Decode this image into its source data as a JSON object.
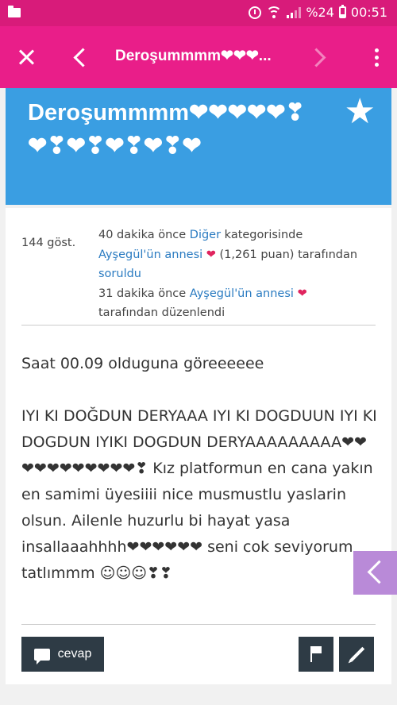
{
  "status_bar": {
    "battery_text": "%24",
    "time": "00:51"
  },
  "app_bar": {
    "title": "Deroşummmm❤❤❤..."
  },
  "question": {
    "title": "Deroşummmm❤❤❤❤❤❣❤❣❤❣❤❣❤❣❤"
  },
  "meta": {
    "views": "144 göst.",
    "asked_time": "40 dakika önce",
    "category": "Diğer",
    "category_suffix": "kategorisinde",
    "author": "Ayşegül'ün annesi",
    "heart": "❤",
    "points": "(1,261 puan)",
    "by": "tarafından",
    "asked_label": "soruldu",
    "edited_time": "31 dakika önce",
    "editor": "Ayşegül'ün annesi",
    "edited_label": "tarafından düzenlendi"
  },
  "body": {
    "paragraph1": "Saat 00.09 olduguna göreeeeee",
    "paragraph2": "IYI KI DOĞDUN DERYAAA IYI KI DOGDUUN IYI KI DOGDUN IYIKI DOGDUN DERYAAAAAAAAA❤❤❤❤❤❤❤❤❤❤❤❣ Kız platformun en cana yakın en samimi üyesiiii nice musmustlu yaslarin olsun. Ailenle huzurlu bi hayat yasa insallaaahhhh❤❤❤❤❤❤ seni cok seviyorum tatlımmm ☺☺☺❣❣"
  },
  "actions": {
    "reply_label": "cevap"
  },
  "colors": {
    "status_bar": "#d81b7a",
    "app_bar": "#e91e89",
    "banner": "#3a9ee2",
    "button": "#2e3b45",
    "link": "#2a7bc1",
    "side_tab": "#b98ad8"
  }
}
